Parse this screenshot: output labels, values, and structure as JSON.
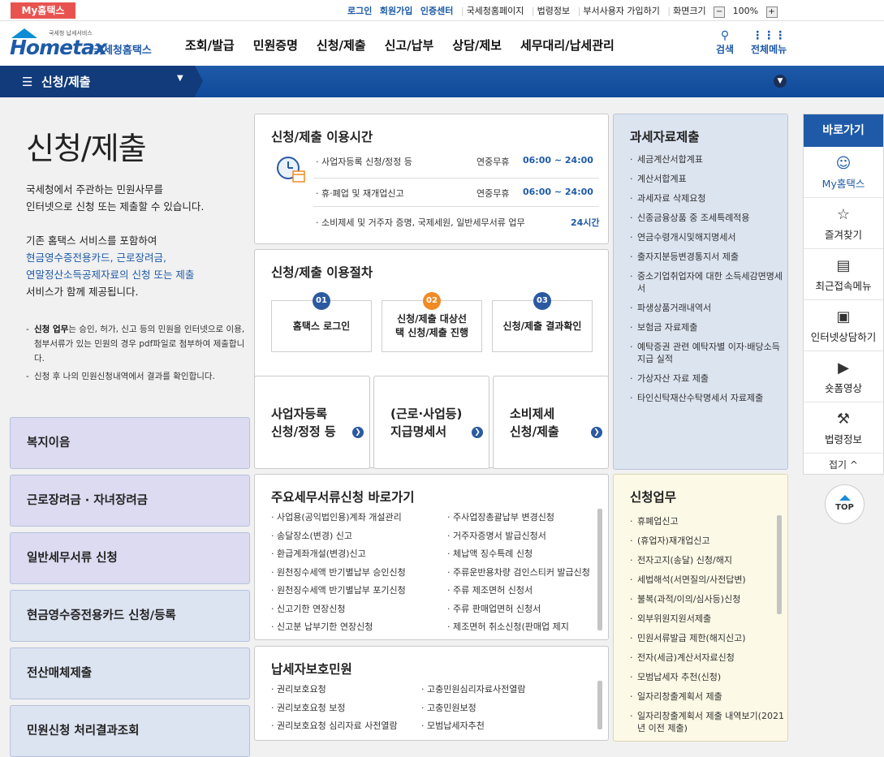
{
  "topbar": {
    "my_hometax": "My홈택스",
    "login": "로그인",
    "signup": "회원가입",
    "cert": "인증센터",
    "nts_home": "국세청홈페이지",
    "law": "법령정보",
    "dept_signup": "부서사용자 가입하기",
    "screen_size": "화면크기",
    "zoom": "100%"
  },
  "header": {
    "logo_sub": "국세청 납세서비스",
    "logo_main": "Hometax",
    "logo_kor": "국세청홈택스",
    "nav": [
      "조회/발급",
      "민원증명",
      "신청/제출",
      "신고/납부",
      "상담/제보",
      "세무대리/납세관리"
    ],
    "search": "검색",
    "all_menu": "전체메뉴"
  },
  "lnb": {
    "title": "신청/제출"
  },
  "intro": {
    "title": "신청/제출",
    "line1": "국세청에서 주관하는 민원사무를",
    "line2": "인터넷으로 신청 또는 제출할 수 있습니다.",
    "line3": "기존 홈택스 서비스를 포함하여",
    "line4": "현금영수증전용카드, 근로장려금,",
    "line5": "연말정산소득공제자료의 신청 또는 제출",
    "line6": "서비스가 함께 제공됩니다.",
    "note1_bold": "신청 업무",
    "note1_text": "는 승인, 허가, 신고 등의 민원을 인터넷으로 이용, 첨부서류가 있는 민원의 경우 pdf파일로 첨부하여 제출합니다.",
    "note2": "신청 후 나의 민원신청내역에서 결과를 확인합니다."
  },
  "left_menu": [
    "복지이음",
    "근로장려금 · 자녀장려금",
    "일반세무서류 신청",
    "현금영수증전용카드 신청/등록",
    "전산매체제출",
    "민원신청 처리결과조회"
  ],
  "usage_time": {
    "title": "신청/제출 이용시간",
    "rows": [
      {
        "label": "· 사업자등록 신청/정정 등",
        "days": "연중무휴",
        "time": "06:00 ~ 24:00"
      },
      {
        "label": "· 휴·폐업 및 재개업신고",
        "days": "연중무휴",
        "time": "06:00 ~ 24:00"
      },
      {
        "label": "· 소비제세 및 거주자 증명, 국제세원, 일반세무서류 업무",
        "days": "",
        "time": "24시간"
      }
    ]
  },
  "procedure": {
    "title": "신청/제출 이용절차",
    "steps": [
      {
        "num": "01",
        "label": "홈택스 로그인"
      },
      {
        "num": "02",
        "label": "신청/제출 대상선택 신청/제출 진행"
      },
      {
        "num": "03",
        "label": "신청/제출 결과확인"
      }
    ],
    "colors": {
      "step1": "#2b5aa0",
      "step2": "#f08a24",
      "step3": "#2b5aa0"
    }
  },
  "tiles": [
    {
      "line1": "사업자등록",
      "line2": "신청/정정 등"
    },
    {
      "line1": "(근로·사업등)",
      "line2": "지급명세서"
    },
    {
      "line1": "소비제세",
      "line2": "신청/제출"
    }
  ],
  "taxdata": {
    "title": "과세자료제출",
    "items": [
      "세금계산서합계표",
      "계산서합계표",
      "과세자료 삭제요청",
      "신종금융상품 중 조세특례적용",
      "연금수령개시및해지명세서",
      "출자지분등변경통지서 제출",
      "중소기업취업자에 대한 소득세감면명세서",
      "파생상품거래내역서",
      "보험금 자료제출",
      "예탁증권 관련 예탁자별 이자·배당소득 지급 실적",
      "가상자산 자료 제출",
      "타인신탁재산수탁명세서 자료제출"
    ]
  },
  "major_docs": {
    "title": "주요세무서류신청 바로가기",
    "col1": [
      "사업용(공익법인용)계좌 개설관리",
      "송달장소(변경) 신고",
      "환급계좌개설(변경)신고",
      "원천징수세액 반기별납부 승인신청",
      "원천징수세액 반기별납부 포기신청",
      "신고기한 연장신청",
      "신고분 납부기한 연장신청"
    ],
    "col2": [
      "주사업장총괄납부 변경신청",
      "거주자증명서 발급신청서",
      "체납액 징수특례 신청",
      "주류운반용차량 검인스티커 발급신청",
      "주류 제조면허 신청서",
      "주류 판매업면허 신청서",
      "제조면허 취소신청(판매업 제지"
    ]
  },
  "apply_work": {
    "title": "신청업무",
    "items": [
      "휴폐업신고",
      "(휴업자)재개업신고",
      "전자고지(송달) 신청/해지",
      "세법해석(서면질의/사전답변)",
      "불복(과적/이의/심사등)신청",
      "외부위원지원서제출",
      "민원서류발급 제한(해지신고)",
      "전자(세금)계산서자료신청",
      "모범납세자 추천(신청)",
      "일자리창출계획서 제출",
      "일자리창출계획서 제출 내역보기(2021년 이전 제출)"
    ]
  },
  "taxpayer": {
    "title": "납세자보호민원",
    "col1": [
      "권리보호요청",
      "권리보호요청 보정",
      "권리보호요청 심리자료 사전열람"
    ],
    "col2": [
      "고충민원심리자료사전열람",
      "고충민원보정",
      "모범납세자추천"
    ]
  },
  "quick": {
    "title": "바로가기",
    "items": [
      {
        "label": "My홈택스",
        "icon": "person-icon"
      },
      {
        "label": "즐겨찾기",
        "icon": "star-icon"
      },
      {
        "label": "최근접속메뉴",
        "icon": "recent-icon"
      },
      {
        "label": "인터넷상담하기",
        "icon": "monitor-icon"
      },
      {
        "label": "숏폼영상",
        "icon": "play-icon"
      },
      {
        "label": "법령정보",
        "icon": "gavel-icon"
      }
    ],
    "fold": "접기 ^",
    "top": "TOP"
  }
}
